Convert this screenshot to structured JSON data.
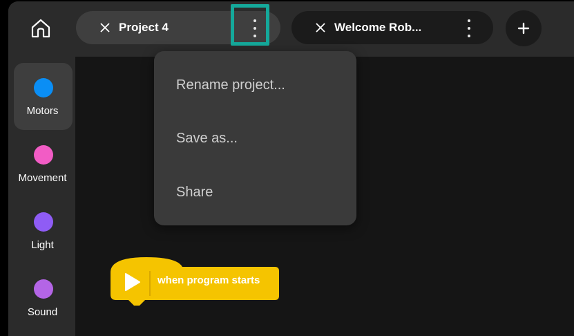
{
  "topbar": {
    "home_icon": "home-icon",
    "tabs": [
      {
        "label": "Project 4",
        "active": true
      },
      {
        "label": "Welcome Rob...",
        "active": false
      }
    ],
    "add_icon": "plus-icon",
    "highlight_color": "#15a99b"
  },
  "sidebar": {
    "categories": [
      {
        "label": "Motors",
        "color": "#0a8ef5",
        "selected": true
      },
      {
        "label": "Movement",
        "color": "#f25cc5",
        "selected": false
      },
      {
        "label": "Light",
        "color": "#8f5cf5",
        "selected": false
      },
      {
        "label": "Sound",
        "color": "#b465e6",
        "selected": false
      }
    ]
  },
  "menu": {
    "items": [
      "Rename project...",
      "Save as...",
      "Share"
    ]
  },
  "canvas": {
    "block": {
      "label": "when program starts",
      "color": "#f5c400"
    }
  }
}
